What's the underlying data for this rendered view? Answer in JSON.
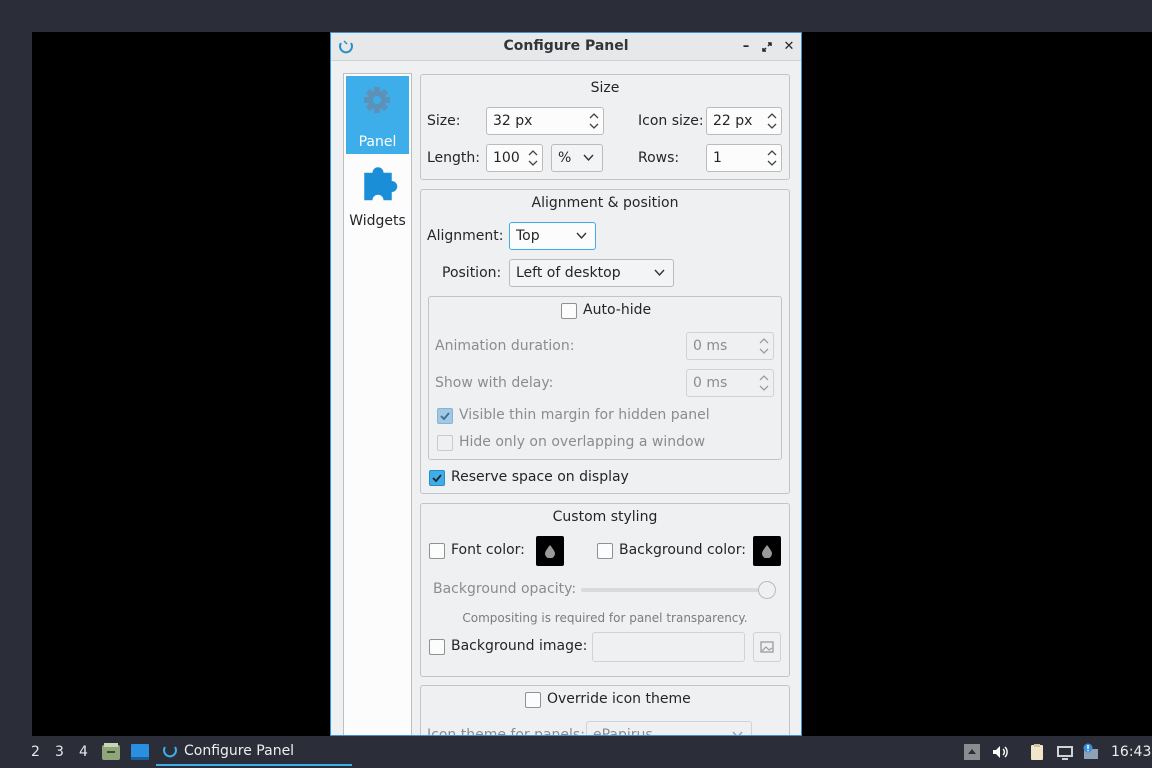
{
  "window": {
    "title": "Configure Panel"
  },
  "sidebar": {
    "items": [
      {
        "label": "Panel",
        "icon": "gear-icon"
      },
      {
        "label": "Widgets",
        "icon": "puzzle-icon"
      }
    ]
  },
  "size_group": {
    "title": "Size",
    "size_label": "Size:",
    "size_value": "32 px",
    "icon_size_label": "Icon size:",
    "icon_size_value": "22 px",
    "length_label": "Length:",
    "length_value": "100",
    "length_unit": "%",
    "rows_label": "Rows:",
    "rows_value": "1"
  },
  "alignment_group": {
    "title": "Alignment & position",
    "alignment_label": "Alignment:",
    "alignment_value": "Top",
    "position_label": "Position:",
    "position_value": "Left of desktop",
    "autohide": {
      "label": "Auto-hide",
      "checked": false,
      "animation_label": "Animation duration:",
      "animation_value": "0 ms",
      "delay_label": "Show with delay:",
      "delay_value": "0 ms",
      "thin_margin_label": "Visible thin margin for hidden panel",
      "thin_margin_checked": true,
      "overlap_label": "Hide only on overlapping a window",
      "overlap_checked": false
    },
    "reserve_label": "Reserve space on display",
    "reserve_checked": true
  },
  "styling_group": {
    "title": "Custom styling",
    "font_color_label": "Font color:",
    "bg_color_label": "Background color:",
    "bg_opacity_label": "Background opacity:",
    "bg_opacity_value": 100,
    "compositing_note": "Compositing is required for panel transparency.",
    "bg_image_label": "Background image:"
  },
  "icon_theme_group": {
    "override_label": "Override icon theme",
    "theme_label": "Icon theme for panels:",
    "theme_value": "ePapirus"
  },
  "taskbar": {
    "workspaces": [
      "2",
      "3",
      "4"
    ],
    "task_label": "Configure Panel",
    "clock": "16:43"
  },
  "colors": {
    "accent": "#3daee9",
    "window_bg": "#eff0f1",
    "desktop": "#000000",
    "taskbar": "#2b2e38"
  }
}
